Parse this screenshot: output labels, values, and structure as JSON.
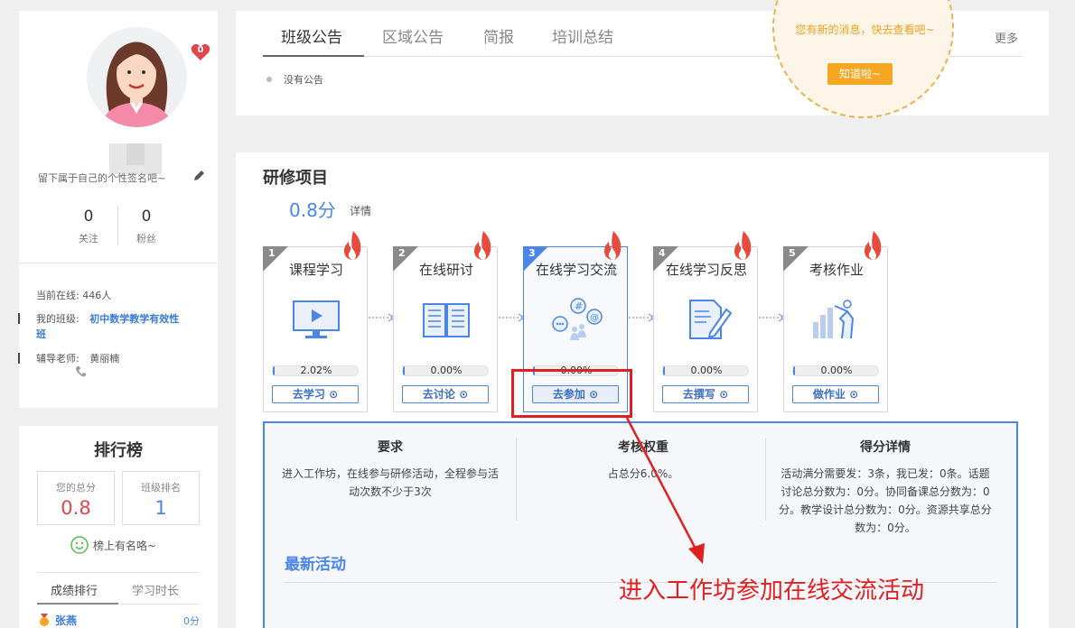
{
  "profile": {
    "message_count": "0",
    "signature": "留下属于自己的个性签名吧~",
    "follow_count": "0",
    "follow_label": "关注",
    "fans_count": "0",
    "fans_label": "粉丝",
    "online_label": "当前在线:",
    "online_value": "446人",
    "class_label": "我的班级:",
    "class_value_1": "初中数学教学有效性",
    "class_value_2": "班",
    "tutor_label": "辅导老师:",
    "tutor_value": "黄丽楠"
  },
  "ranking": {
    "title": "排行榜",
    "total_label": "您的总分",
    "total_value": "0.8",
    "rank_label": "班级排名",
    "rank_value": "1",
    "notice": "榜上有名咯~",
    "tabs": [
      "成绩排行",
      "学习时长"
    ],
    "row_name": "张燕",
    "row_score": "0分"
  },
  "notices": {
    "tabs": [
      "班级公告",
      "区域公告",
      "简报",
      "培训总结"
    ],
    "more": "更多",
    "empty": "没有公告",
    "bubble_text": "您有新的消息，快去查看吧~",
    "bubble_button": "知道啦~"
  },
  "project": {
    "title": "研修项目",
    "score": "0.8分",
    "detail": "详情",
    "steps": [
      {
        "num": "1",
        "title": "课程学习",
        "progress_text": "2.02%",
        "progress": 0.0202,
        "button": "去学习",
        "icon": "monitor-play-icon"
      },
      {
        "num": "2",
        "title": "在线研讨",
        "progress_text": "0.00%",
        "progress": 0,
        "button": "去讨论",
        "icon": "open-book-icon"
      },
      {
        "num": "3",
        "title": "在线学习交流",
        "progress_text": "0.00%",
        "progress": 0,
        "button": "去参加",
        "icon": "chat-bubbles-icon"
      },
      {
        "num": "4",
        "title": "在线学习反思",
        "progress_text": "0.00%",
        "progress": 0,
        "button": "去撰写",
        "icon": "document-pencil-icon"
      },
      {
        "num": "5",
        "title": "考核作业",
        "progress_text": "0.00%",
        "progress": 0,
        "button": "做作业",
        "icon": "presenter-chart-icon"
      }
    ],
    "req_title": "要求",
    "req_text": "进入工作坊，在线参与研修活动，全程参与活动次数不少于3次",
    "weight_title": "考核权重",
    "weight_text": "占总分6.0%。",
    "score_title": "得分详情",
    "score_text": "活动满分需要发：3条，我已发：0条。话题讨论总分数为：0分。协同备课总分数为：0分。教学设计总分数为：0分。资源共享总分数为：0分。",
    "latest_title": "最新活动"
  },
  "annotation": "进入工作坊参加在线交流活动",
  "colors": {
    "accent": "#4a86e8",
    "annotation": "#e02020",
    "badge": "#f5a623",
    "score_red": "#e0474c"
  }
}
